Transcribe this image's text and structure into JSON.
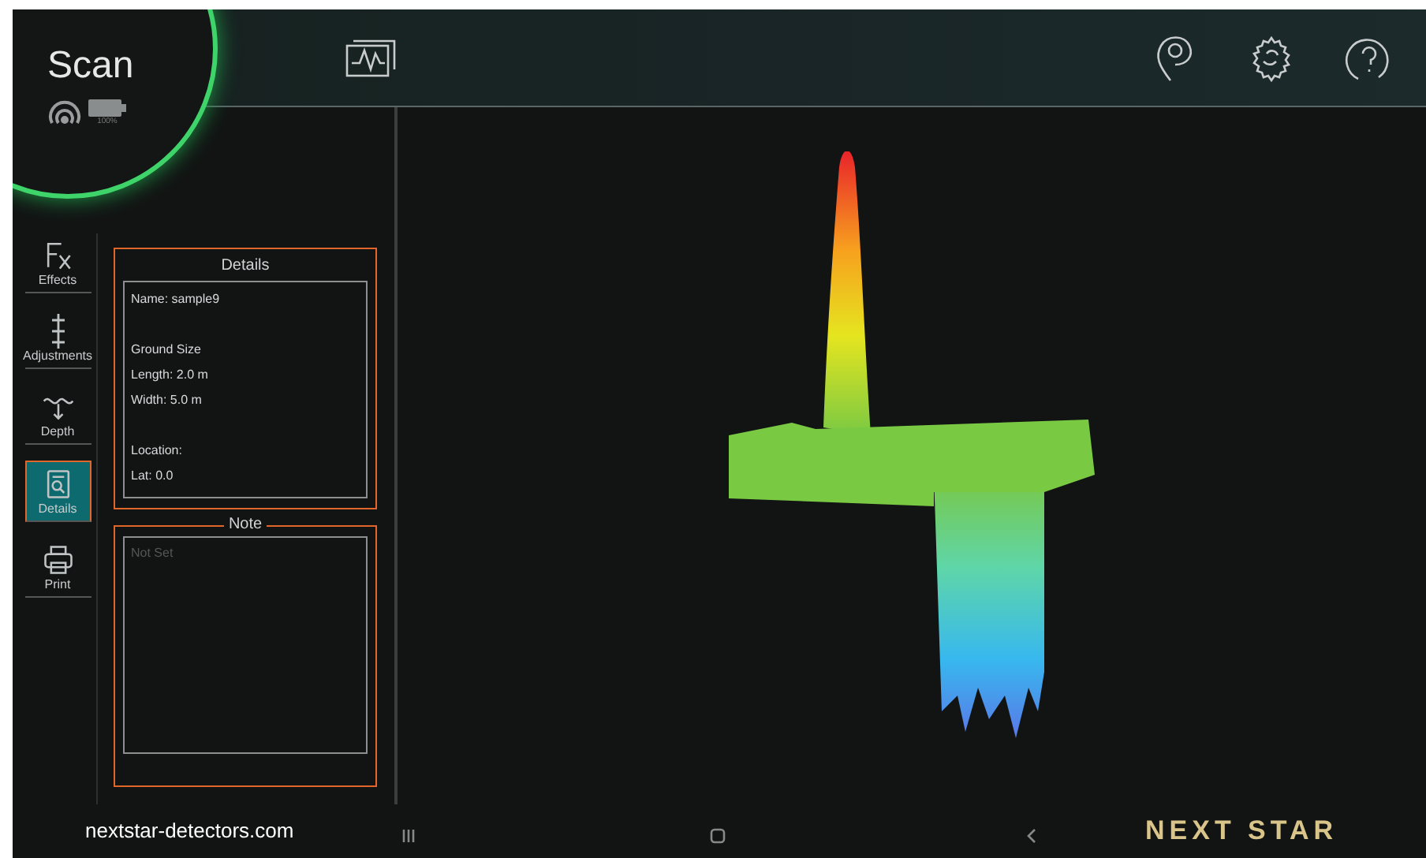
{
  "header": {
    "title": "Scan",
    "battery": "100%"
  },
  "sidebar": {
    "items": [
      {
        "label": "Effects",
        "selected": false
      },
      {
        "label": "Adjustments",
        "selected": false
      },
      {
        "label": "Depth",
        "selected": false
      },
      {
        "label": "Details",
        "selected": true
      },
      {
        "label": "Print",
        "selected": false
      }
    ]
  },
  "details": {
    "title": "Details",
    "groups": [
      [
        "Name: sample9"
      ],
      [
        "Ground Size",
        "Length: 2.0 m",
        "Width: 5.0 m"
      ],
      [
        "Location:",
        "Lat: 0.0"
      ]
    ]
  },
  "note": {
    "title": "Note",
    "placeholder": "Not Set"
  },
  "footer": {
    "website": "nextstar-detectors.com",
    "logo": "NEXT STAR"
  }
}
